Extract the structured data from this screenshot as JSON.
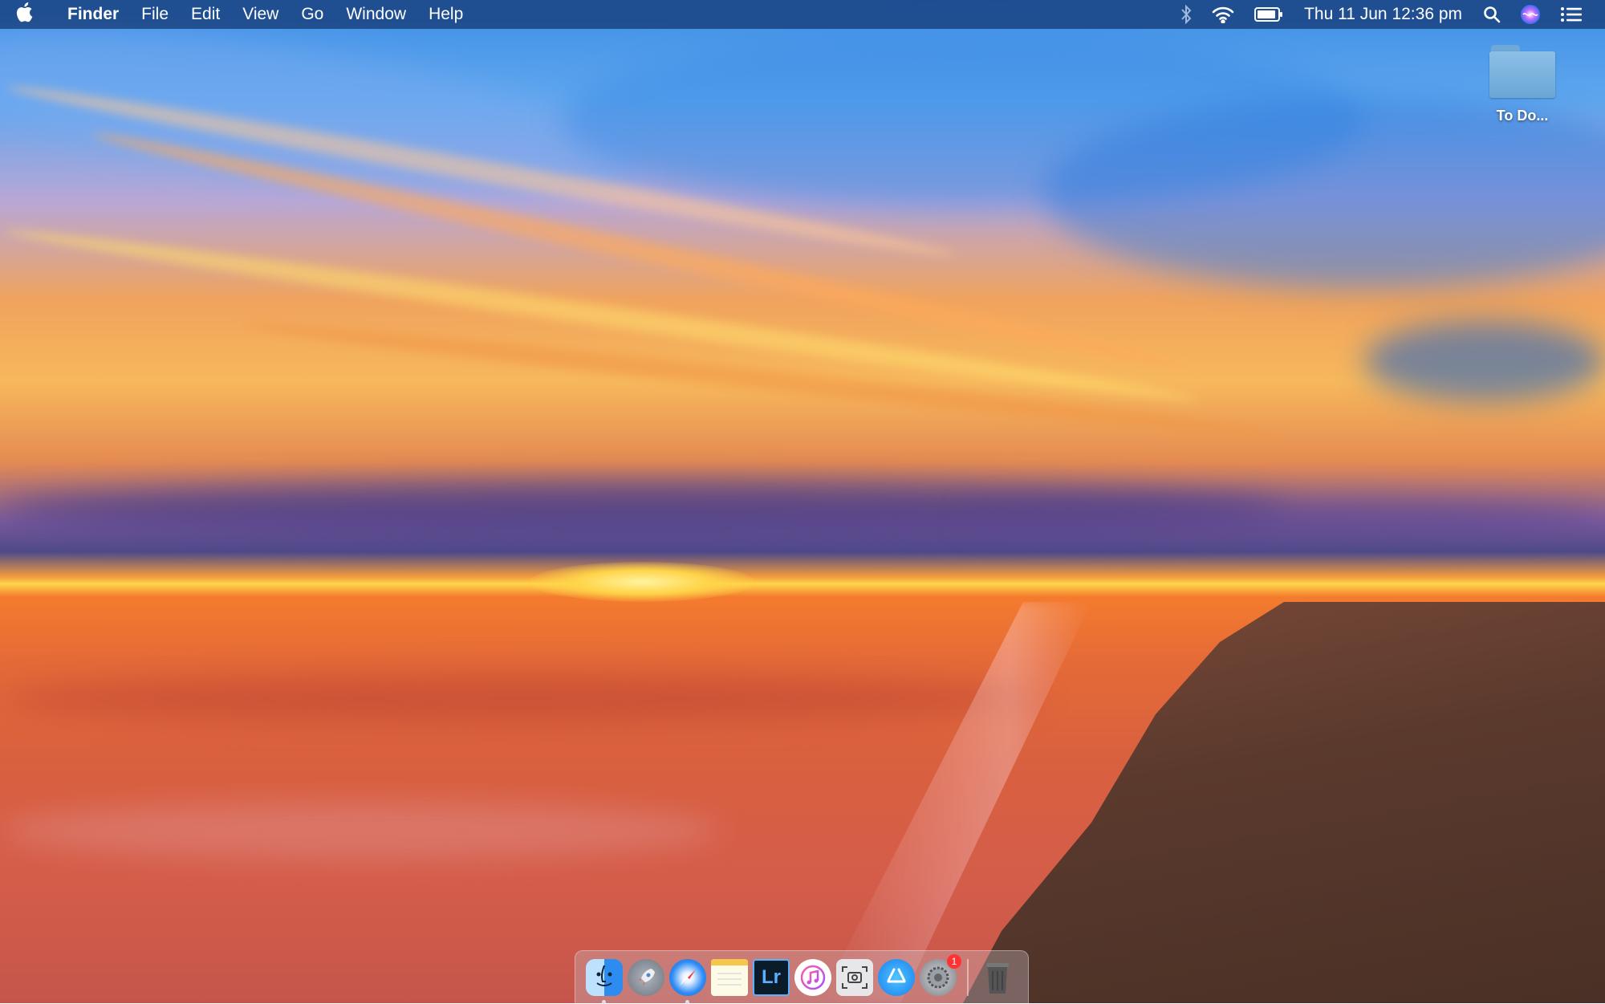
{
  "menubar": {
    "apple_icon": "apple-logo-icon",
    "app_name": "Finder",
    "menus": [
      "File",
      "Edit",
      "View",
      "Go",
      "Window",
      "Help"
    ],
    "status_icons": [
      "bluetooth-icon",
      "wifi-icon",
      "battery-icon"
    ],
    "datetime": "Thu 11 Jun  12:36 pm",
    "right_icons": [
      "spotlight-search-icon",
      "siri-icon",
      "notification-center-icon"
    ]
  },
  "desktop": {
    "folders": [
      {
        "label": "To Do..."
      }
    ]
  },
  "dock": {
    "apps": [
      {
        "name": "Finder",
        "icon": "finder-icon",
        "running": true
      },
      {
        "name": "Launchpad",
        "icon": "launchpad-icon",
        "running": false
      },
      {
        "name": "Safari",
        "icon": "safari-icon",
        "running": true
      },
      {
        "name": "Notes",
        "icon": "notes-icon",
        "running": false
      },
      {
        "name": "Lightroom",
        "icon": "lightroom-icon",
        "label": "Lr",
        "running": false
      },
      {
        "name": "iTunes",
        "icon": "itunes-icon",
        "running": false
      },
      {
        "name": "Screenshot",
        "icon": "screenshot-icon",
        "running": false
      },
      {
        "name": "App Store",
        "icon": "app-store-icon",
        "running": false
      },
      {
        "name": "System Preferences",
        "icon": "system-preferences-icon",
        "badge": "1",
        "running": false
      }
    ],
    "trash_icon": "trash-icon"
  },
  "colors": {
    "menubar_bg": "#163c78",
    "dock_dot": "#dddde8",
    "badge": "#ff3333"
  }
}
